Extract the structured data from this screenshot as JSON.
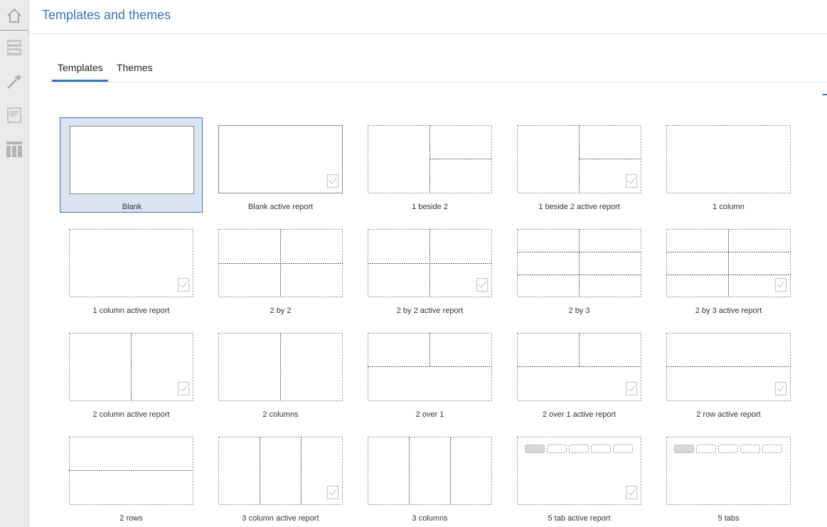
{
  "header": {
    "title": "Templates and themes"
  },
  "tabs": [
    {
      "label": "Templates",
      "active": true
    },
    {
      "label": "Themes",
      "active": false
    }
  ],
  "rail": [
    "home-icon",
    "data-icon",
    "hammer-icon",
    "report-icon",
    "columns-icon"
  ],
  "colors": {
    "accent": "#3b73b9",
    "selected_bg": "#d9e4f0",
    "rail_bg": "#eaeaea"
  },
  "templates": [
    {
      "label": "Blank",
      "selected": true
    },
    {
      "label": "Blank active report"
    },
    {
      "label": "1 beside 2"
    },
    {
      "label": "1 beside 2 active report"
    },
    {
      "label": "1 column"
    },
    {
      "label": "1 column active report"
    },
    {
      "label": "2 by 2"
    },
    {
      "label": "2 by 2 active report"
    },
    {
      "label": "2 by 3"
    },
    {
      "label": "2 by 3 active report"
    },
    {
      "label": "2 column active report"
    },
    {
      "label": "2 columns"
    },
    {
      "label": "2 over 1"
    },
    {
      "label": "2 over 1 active report"
    },
    {
      "label": "2 row active report"
    },
    {
      "label": "2 rows"
    },
    {
      "label": "3 column active report"
    },
    {
      "label": "3 columns"
    },
    {
      "label": "5 tab active report"
    },
    {
      "label": "5 tabs"
    }
  ]
}
